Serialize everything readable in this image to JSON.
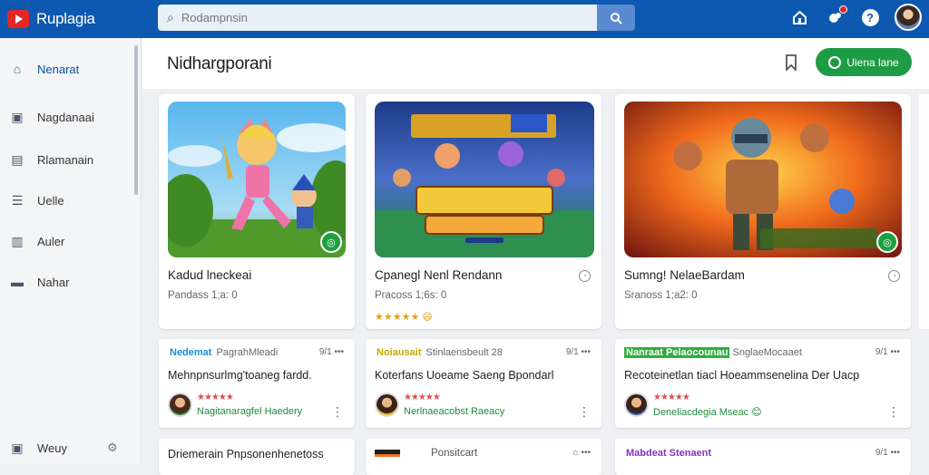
{
  "app": {
    "name": "Ruplagia"
  },
  "search": {
    "placeholder": "Rodampnsin",
    "search_icon": "search-icon",
    "button_icon": "search-icon"
  },
  "topbar": {
    "icons": [
      "home-icon",
      "notifications-icon",
      "help-icon",
      "avatar"
    ]
  },
  "sidebar": {
    "items": [
      {
        "label": "Nenarat",
        "icon": "home-icon",
        "active": true
      },
      {
        "label": "Nagdanaai",
        "icon": "store-icon",
        "active": false
      },
      {
        "label": "Rlamanain",
        "icon": "library-icon",
        "active": false
      },
      {
        "label": "Uelle",
        "icon": "list-icon",
        "active": false
      },
      {
        "label": "Auler",
        "icon": "stats-icon",
        "active": false
      },
      {
        "label": "Nahar",
        "icon": "tag-icon",
        "active": false
      }
    ],
    "footer": {
      "label": "Weuy",
      "icon": "settings-icon"
    }
  },
  "main": {
    "title": "Nidhargporani",
    "primary_button": "Uiena lane",
    "bookmark_icon": "bookmark-icon"
  },
  "game_cards": [
    {
      "title": "Kadud lneckeai",
      "meta": "Pandass 1;a: 0",
      "rating": "",
      "theme": "fox"
    },
    {
      "title": "Cpanegl Nenl Rendann",
      "meta": "Pracoss 1;6s: 0",
      "rating": "★★★★★ 😄",
      "theme": "squad"
    },
    {
      "title": "Sumng! NelaeBardam",
      "meta": "Sranoss 1;a2: 0",
      "rating": "",
      "theme": "hero"
    }
  ],
  "posts": [
    {
      "tag": "Nedemat",
      "tag_color": "#1a8fd6",
      "sub": "PagrahMleadi",
      "time": "9/1 •••",
      "body": "Mehnpnsurlmg'toaneg fardd.",
      "stars": "★★★★★",
      "user": "Nagitanaragfel Haedery"
    },
    {
      "tag": "Noiausait",
      "tag_color": "#e5c400",
      "sub": "Stinlaensbeult 28",
      "time": "9/1 •••",
      "body": "Koterfans Uoeame Saeng Bpondarl",
      "stars": "★★★★★",
      "user": "Nerlnaeacobst Raeacy"
    },
    {
      "tag": "Nanraat Pelaocounau",
      "tag_color": "#2fae3c",
      "sub": "SnglaeMocaaet",
      "time": "9/1 •••",
      "body": "Recoteinetlan tiacl Hoeammsenelina Der Uacp",
      "stars": "★★★★★",
      "user": "Deneliacdegia Mseac 😊"
    }
  ],
  "bottom_row": [
    {
      "text": "Driemerain Pnpsonenhenetoss"
    },
    {
      "text": "Ponsitcart",
      "icon": "pin-icon"
    },
    {
      "text": "Mabdeat Stenaent",
      "time": "9/1 •••"
    }
  ]
}
